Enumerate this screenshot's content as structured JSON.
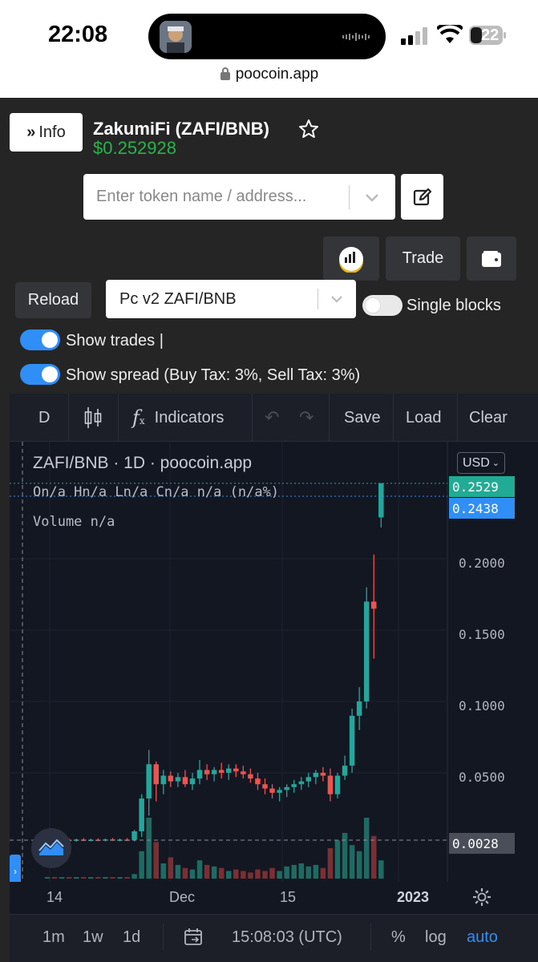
{
  "status_bar": {
    "time": "22:08",
    "battery": "22",
    "url": "poocoin.app"
  },
  "header": {
    "info_label": "Info",
    "token_title": "ZakumiFi (ZAFI/BNB)",
    "price": "$0.252928"
  },
  "search": {
    "placeholder": "Enter token name / address..."
  },
  "actions": {
    "trade_label": "Trade"
  },
  "controls": {
    "reload_label": "Reload",
    "pair_value": "Pc v2 ZAFI/BNB",
    "single_blocks_label": "Single blocks",
    "single_blocks_on": false,
    "show_trades_label": "Show trades |",
    "show_trades_on": true,
    "show_spread_label": "Show spread (Buy Tax: 3%, Sell Tax: 3%)",
    "show_spread_on": true
  },
  "toolbar": {
    "interval": "D",
    "indicators_label": "Indicators",
    "save_label": "Save",
    "load_label": "Load",
    "clear_label": "Clear"
  },
  "legend": {
    "symbol": "ZAFI/BNB · 1D · poocoin.app",
    "ohlc": "On/a Hn/a Ln/a Cn/a n/a (n/a%)",
    "volume": "Volume  n/a"
  },
  "price_scale": {
    "currency": "USD",
    "tags": [
      {
        "value": "0.2529",
        "color": "#22ab94"
      },
      {
        "value": "0.2438",
        "color": "#2f8ff6"
      },
      {
        "value": "0.0028",
        "color": "#4a4e59"
      }
    ],
    "ticks": [
      "0.2000",
      "0.1500",
      "0.1000",
      "0.0500"
    ]
  },
  "time_axis": {
    "labels": [
      "14",
      "Dec",
      "15",
      "2023"
    ]
  },
  "bottom_bar": {
    "ranges": [
      "1m",
      "1w",
      "1d"
    ],
    "time": "15:08:03 (UTC)",
    "percent": "%",
    "log": "log",
    "auto": "auto"
  },
  "chart_data": {
    "type": "candlestick",
    "pair": "ZAFI/BNB",
    "interval": "1D",
    "currency": "USD",
    "ylim": [
      0,
      0.26
    ],
    "y_ticks": [
      0.05,
      0.1,
      0.15,
      0.2
    ],
    "x_tick_labels": [
      "14",
      "Dec",
      "15",
      "2023"
    ],
    "candles": [
      {
        "o": 0.002,
        "h": 0.004,
        "l": 0.001,
        "c": 0.003
      },
      {
        "o": 0.003,
        "h": 0.004,
        "l": 0.002,
        "c": 0.0025
      },
      {
        "o": 0.0025,
        "h": 0.0035,
        "l": 0.0015,
        "c": 0.003
      },
      {
        "o": 0.003,
        "h": 0.004,
        "l": 0.002,
        "c": 0.0028
      },
      {
        "o": 0.0028,
        "h": 0.0038,
        "l": 0.0018,
        "c": 0.0032
      },
      {
        "o": 0.0032,
        "h": 0.0042,
        "l": 0.0022,
        "c": 0.0029
      },
      {
        "o": 0.0029,
        "h": 0.0039,
        "l": 0.0019,
        "c": 0.0031
      },
      {
        "o": 0.0031,
        "h": 0.0041,
        "l": 0.0021,
        "c": 0.003
      },
      {
        "o": 0.003,
        "h": 0.004,
        "l": 0.002,
        "c": 0.0033
      },
      {
        "o": 0.0033,
        "h": 0.0043,
        "l": 0.0023,
        "c": 0.003
      },
      {
        "o": 0.003,
        "h": 0.004,
        "l": 0.002,
        "c": 0.0032
      },
      {
        "o": 0.0032,
        "h": 0.0042,
        "l": 0.0022,
        "c": 0.0031
      },
      {
        "o": 0.0031,
        "h": 0.01,
        "l": 0.002,
        "c": 0.009
      },
      {
        "o": 0.009,
        "h": 0.035,
        "l": 0.005,
        "c": 0.032
      },
      {
        "o": 0.032,
        "h": 0.066,
        "l": 0.02,
        "c": 0.056
      },
      {
        "o": 0.056,
        "h": 0.058,
        "l": 0.03,
        "c": 0.042
      },
      {
        "o": 0.042,
        "h": 0.052,
        "l": 0.035,
        "c": 0.048
      },
      {
        "o": 0.048,
        "h": 0.051,
        "l": 0.04,
        "c": 0.044
      },
      {
        "o": 0.044,
        "h": 0.05,
        "l": 0.04,
        "c": 0.047
      },
      {
        "o": 0.047,
        "h": 0.052,
        "l": 0.04,
        "c": 0.042
      },
      {
        "o": 0.042,
        "h": 0.05,
        "l": 0.038,
        "c": 0.046
      },
      {
        "o": 0.046,
        "h": 0.059,
        "l": 0.042,
        "c": 0.052
      },
      {
        "o": 0.052,
        "h": 0.056,
        "l": 0.045,
        "c": 0.049
      },
      {
        "o": 0.049,
        "h": 0.054,
        "l": 0.044,
        "c": 0.052
      },
      {
        "o": 0.052,
        "h": 0.057,
        "l": 0.046,
        "c": 0.05
      },
      {
        "o": 0.05,
        "h": 0.056,
        "l": 0.045,
        "c": 0.053
      },
      {
        "o": 0.053,
        "h": 0.056,
        "l": 0.047,
        "c": 0.051
      },
      {
        "o": 0.051,
        "h": 0.055,
        "l": 0.046,
        "c": 0.049
      },
      {
        "o": 0.049,
        "h": 0.053,
        "l": 0.043,
        "c": 0.046
      },
      {
        "o": 0.046,
        "h": 0.05,
        "l": 0.038,
        "c": 0.042
      },
      {
        "o": 0.042,
        "h": 0.046,
        "l": 0.035,
        "c": 0.039
      },
      {
        "o": 0.039,
        "h": 0.042,
        "l": 0.032,
        "c": 0.036
      },
      {
        "o": 0.036,
        "h": 0.04,
        "l": 0.03,
        "c": 0.038
      },
      {
        "o": 0.038,
        "h": 0.042,
        "l": 0.033,
        "c": 0.04
      },
      {
        "o": 0.04,
        "h": 0.045,
        "l": 0.036,
        "c": 0.042
      },
      {
        "o": 0.042,
        "h": 0.047,
        "l": 0.038,
        "c": 0.044
      },
      {
        "o": 0.044,
        "h": 0.05,
        "l": 0.04,
        "c": 0.047
      },
      {
        "o": 0.047,
        "h": 0.052,
        "l": 0.042,
        "c": 0.05
      },
      {
        "o": 0.05,
        "h": 0.054,
        "l": 0.044,
        "c": 0.048
      },
      {
        "o": 0.048,
        "h": 0.053,
        "l": 0.03,
        "c": 0.035
      },
      {
        "o": 0.035,
        "h": 0.05,
        "l": 0.032,
        "c": 0.048
      },
      {
        "o": 0.048,
        "h": 0.062,
        "l": 0.045,
        "c": 0.055
      },
      {
        "o": 0.055,
        "h": 0.095,
        "l": 0.05,
        "c": 0.09
      },
      {
        "o": 0.09,
        "h": 0.11,
        "l": 0.08,
        "c": 0.1
      },
      {
        "o": 0.1,
        "h": 0.18,
        "l": 0.095,
        "c": 0.17
      },
      {
        "o": 0.17,
        "h": 0.203,
        "l": 0.13,
        "c": 0.165
      },
      {
        "o": 0.229,
        "h": 0.253,
        "l": 0.222,
        "c": 0.2529
      }
    ],
    "volume": [
      1,
      1,
      1,
      1,
      1,
      1,
      1,
      1,
      1,
      1,
      1,
      1,
      3,
      18,
      40,
      24,
      10,
      14,
      9,
      7,
      6,
      12,
      9,
      8,
      7,
      5,
      6,
      5,
      4,
      6,
      5,
      7,
      5,
      8,
      9,
      10,
      8,
      9,
      7,
      20,
      25,
      30,
      22,
      18,
      40,
      28,
      12
    ]
  }
}
